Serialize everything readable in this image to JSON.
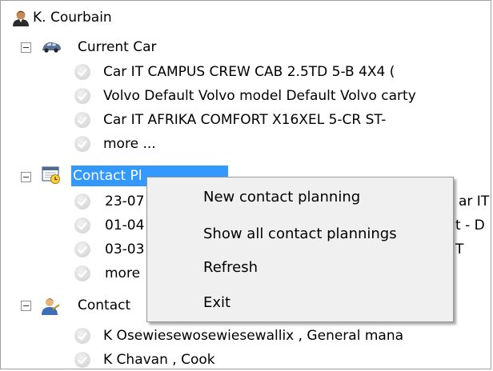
{
  "tree": {
    "root": {
      "label": "K. Courbain",
      "icon": "person-icon"
    },
    "groups": [
      {
        "label": "Current Car",
        "icon": "car-icon",
        "items": [
          "Car IT CAMPUS CREW CAB 2.5TD 5-B 4X4 (",
          "Volvo Default Volvo model Default Volvo carty",
          "Car IT AFRIKA COMFORT X16XEL 5-CR ST-",
          "more ..."
        ]
      },
      {
        "label": "Contact Planning",
        "visible_label": "Contact Pl",
        "icon": "calendar-clock-icon",
        "selected": true,
        "items": [
          "23-07",
          "01-04",
          "03-03",
          "more"
        ],
        "items_right": [
          "ar IT",
          "t - D",
          "T",
          ""
        ]
      },
      {
        "label": "Contact",
        "icon": "contact-person-icon",
        "items": [
          "K Osewiesewosewiesewallix , General mana",
          "K Chavan , Cook"
        ]
      }
    ]
  },
  "context_menu": {
    "items": [
      "New contact planning",
      "Show all contact plannings",
      "Refresh",
      "Exit"
    ]
  },
  "colors": {
    "selection": "#3399ff",
    "menu_background": "#f0f0f0"
  }
}
